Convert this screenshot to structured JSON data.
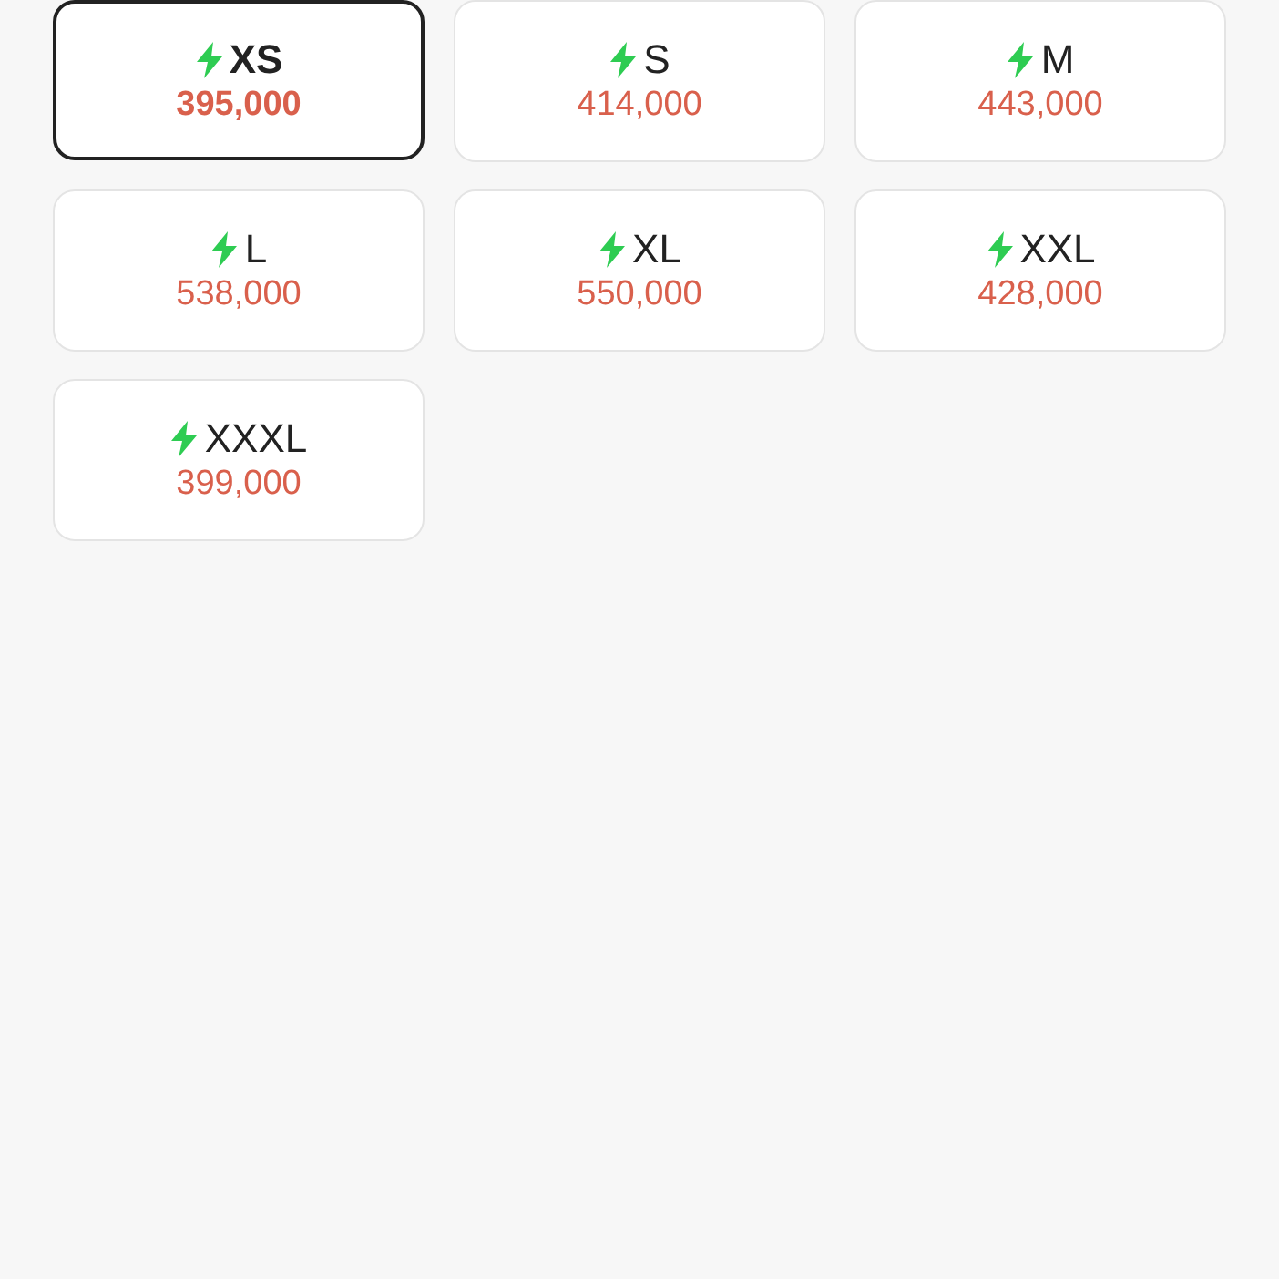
{
  "sizes": [
    {
      "label": "XS",
      "price": "395,000",
      "selected": true
    },
    {
      "label": "S",
      "price": "414,000",
      "selected": false
    },
    {
      "label": "M",
      "price": "443,000",
      "selected": false
    },
    {
      "label": "L",
      "price": "538,000",
      "selected": false
    },
    {
      "label": "XL",
      "price": "550,000",
      "selected": false
    },
    {
      "label": "XXL",
      "price": "428,000",
      "selected": false
    },
    {
      "label": "XXXL",
      "price": "399,000",
      "selected": false
    }
  ]
}
